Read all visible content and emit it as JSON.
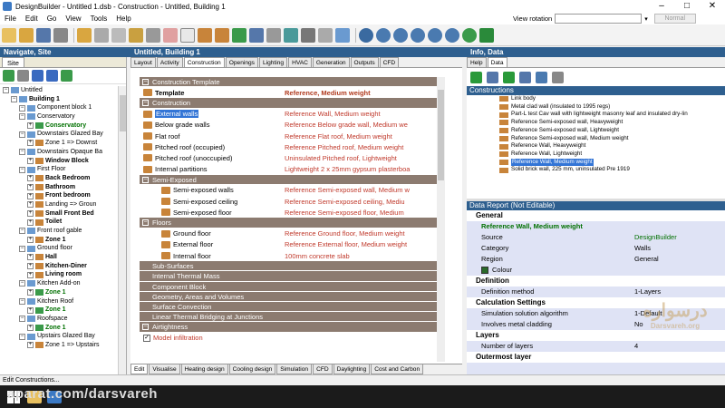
{
  "window": {
    "title": "DesignBuilder - Untitled 1.dsb - Construction - Untitled, Building 1",
    "controls": [
      "–",
      "□",
      "✕"
    ]
  },
  "menu": [
    "File",
    "Edit",
    "Go",
    "View",
    "Tools",
    "Help"
  ],
  "view_rotation": {
    "label": "View rotation",
    "value": "Axonometric",
    "mode": "Normal"
  },
  "panels": {
    "navigate": "Navigate, Site",
    "center": "Untitled, Building 1",
    "info": "Info, Data"
  },
  "left": {
    "tab": "Site",
    "tree": [
      {
        "indent": 0,
        "text": "Untitled",
        "style": ""
      },
      {
        "indent": 1,
        "text": "Building 1",
        "style": "bold"
      },
      {
        "indent": 2,
        "text": "Component block 1",
        "style": ""
      },
      {
        "indent": 2,
        "text": "Conservatory",
        "style": ""
      },
      {
        "indent": 3,
        "text": "Conservatory",
        "style": "grn"
      },
      {
        "indent": 2,
        "text": "Downstairs Glazed Bay",
        "style": ""
      },
      {
        "indent": 3,
        "text": "Zone 1 => Downst",
        "style": ""
      },
      {
        "indent": 2,
        "text": "Downstairs Opaque Ba",
        "style": ""
      },
      {
        "indent": 3,
        "text": "Window Block",
        "style": "bold"
      },
      {
        "indent": 2,
        "text": "First Floor",
        "style": ""
      },
      {
        "indent": 3,
        "text": "Back Bedroom",
        "style": "bold"
      },
      {
        "indent": 3,
        "text": "Bathroom",
        "style": "bold"
      },
      {
        "indent": 3,
        "text": "Front bedroom",
        "style": "bold"
      },
      {
        "indent": 3,
        "text": "Landing => Groun",
        "style": ""
      },
      {
        "indent": 3,
        "text": "Small Front Bed",
        "style": "bold"
      },
      {
        "indent": 3,
        "text": "Toilet",
        "style": "bold"
      },
      {
        "indent": 2,
        "text": "Front roof gable",
        "style": ""
      },
      {
        "indent": 3,
        "text": "Zone 1",
        "style": "bold"
      },
      {
        "indent": 2,
        "text": "Ground floor",
        "style": ""
      },
      {
        "indent": 3,
        "text": "Hall",
        "style": "bold"
      },
      {
        "indent": 3,
        "text": "Kitchen-Diner",
        "style": "bold"
      },
      {
        "indent": 3,
        "text": "Living room",
        "style": "bold"
      },
      {
        "indent": 2,
        "text": "Kitchen Add-on",
        "style": ""
      },
      {
        "indent": 3,
        "text": "Zone 1",
        "style": "grn"
      },
      {
        "indent": 2,
        "text": "Kitchen Roof",
        "style": ""
      },
      {
        "indent": 3,
        "text": "Zone 1",
        "style": "grn"
      },
      {
        "indent": 2,
        "text": "Roofspace",
        "style": ""
      },
      {
        "indent": 3,
        "text": "Zone 1",
        "style": "grn"
      },
      {
        "indent": 2,
        "text": "Upstairs Glazed Bay",
        "style": ""
      },
      {
        "indent": 3,
        "text": "Zone 1 => Upstairs",
        "style": ""
      }
    ]
  },
  "center": {
    "tabs": [
      "Layout",
      "Activity",
      "Construction",
      "Openings",
      "Lighting",
      "HVAC",
      "Generation",
      "Outputs",
      "CFD"
    ],
    "active_tab": "Construction",
    "bottom_tabs": [
      "Edit",
      "Visualise",
      "Heating design",
      "Cooling design",
      "Simulation",
      "CFD",
      "Daylighting",
      "Cost and Carbon"
    ],
    "rows": [
      {
        "type": "header",
        "text": "Construction Template",
        "collapse": true
      },
      {
        "type": "row",
        "label": "Template",
        "value": "Reference, Medium weight",
        "indent": 0,
        "bold": true
      },
      {
        "type": "header",
        "text": "Construction",
        "collapse": true
      },
      {
        "type": "row",
        "label": "External walls",
        "value": "Reference Wall, Medium weight",
        "indent": 0,
        "selected": true
      },
      {
        "type": "row",
        "label": "Below grade walls",
        "value": "Reference Below grade wall, Medium we",
        "indent": 0
      },
      {
        "type": "row",
        "label": "Flat roof",
        "value": "Reference Flat roof, Medium weight",
        "indent": 0
      },
      {
        "type": "row",
        "label": "Pitched roof (occupied)",
        "value": "Reference Pitched roof, Medium weight",
        "indent": 0
      },
      {
        "type": "row",
        "label": "Pitched roof (unoccupied)",
        "value": "Uninsulated Pitched roof, Lightweight",
        "indent": 0
      },
      {
        "type": "row",
        "label": "Internal partitions",
        "value": "Lightweight 2 x 25mm gypsum plasterboa",
        "indent": 0
      },
      {
        "type": "header",
        "text": "Semi-Exposed",
        "collapse": true,
        "sub": true
      },
      {
        "type": "row",
        "label": "Semi-exposed walls",
        "value": "Reference Semi-exposed wall, Medium w",
        "indent": 1
      },
      {
        "type": "row",
        "label": "Semi-exposed ceiling",
        "value": "Reference Semi-exposed ceiling, Mediu",
        "indent": 1
      },
      {
        "type": "row",
        "label": "Semi-exposed floor",
        "value": "Reference Semi-exposed floor, Medium",
        "indent": 1
      },
      {
        "type": "header",
        "text": "Floors",
        "collapse": true,
        "sub": true
      },
      {
        "type": "row",
        "label": "Ground floor",
        "value": "Reference Ground floor, Medium weight",
        "indent": 1
      },
      {
        "type": "row",
        "label": "External floor",
        "value": "Reference External floor, Medium weight",
        "indent": 1
      },
      {
        "type": "row",
        "label": "Internal floor",
        "value": "100mm concrete slab",
        "indent": 1
      },
      {
        "type": "header",
        "text": "Sub-Surfaces",
        "arrow": "»"
      },
      {
        "type": "header",
        "text": "Internal Thermal Mass",
        "arrow": "»"
      },
      {
        "type": "header",
        "text": "Component Block",
        "arrow": "»"
      },
      {
        "type": "header",
        "text": "Geometry, Areas and Volumes",
        "arrow": "»"
      },
      {
        "type": "header",
        "text": "Surface Convection",
        "arrow": "»"
      },
      {
        "type": "header",
        "text": "Linear Thermal Bridging at Junctions",
        "arrow": "»"
      },
      {
        "type": "header",
        "text": "Airtightness",
        "collapse": true
      },
      {
        "type": "check",
        "label": "Model infiltration",
        "checked": true
      }
    ]
  },
  "right": {
    "tabs": [
      "Help",
      "Data"
    ],
    "active_tab": "Data",
    "constructions_title": "Constructions",
    "constructions": [
      "Link body",
      "Metal clad wall (insulated to 1995 regs)",
      "Part-L test Cav wall with lightweight masonry leaf and insulated dry-lin",
      "Reference Semi-exposed wall, Heavyweight",
      "Reference Semi-exposed wall, Lightweight",
      "Reference Semi-exposed wall, Medium weight",
      "Reference Wall, Heavyweight",
      "Reference Wall, Lightweight",
      "Reference Wall, Medium weight",
      "Solid brick wall, 225 mm, uninsulated Pre 1919"
    ],
    "selected_construction": "Reference Wall, Medium weight",
    "report_title": "Data Report (Not Editable)",
    "report": [
      {
        "type": "section",
        "text": "General"
      },
      {
        "type": "title",
        "text": "Reference Wall, Medium weight"
      },
      {
        "type": "kv",
        "k": "Source",
        "v": "DesignBuilder",
        "green": true
      },
      {
        "type": "kv",
        "k": "Category",
        "v": "Walls"
      },
      {
        "type": "kv",
        "k": "Region",
        "v": "General"
      },
      {
        "type": "kv",
        "k": "Colour",
        "v": ""
      },
      {
        "type": "section",
        "text": "Definition"
      },
      {
        "type": "kv",
        "k": "Definition method",
        "v": "1-Layers"
      },
      {
        "type": "section",
        "text": "Calculation Settings"
      },
      {
        "type": "kv",
        "k": "Simulation solution algorithm",
        "v": "1-Default"
      },
      {
        "type": "kv",
        "k": "Involves metal cladding",
        "v": "No"
      },
      {
        "type": "section",
        "text": "Layers"
      },
      {
        "type": "kv",
        "k": "Number of layers",
        "v": "4"
      },
      {
        "type": "section",
        "text": "Outermost layer"
      }
    ]
  },
  "status": "Edit Constructions...",
  "watermark": {
    "text": "aparat.com/darsvareh",
    "logo": "درسواره",
    "logo_sub": "Darsvareh.org"
  },
  "colors": {
    "header_bg": "#8c7b70",
    "value_red": "#c0392b",
    "title_blue": "#2e5f8f",
    "select_blue": "#3375d6",
    "report_bg": "#dfe3f5"
  }
}
